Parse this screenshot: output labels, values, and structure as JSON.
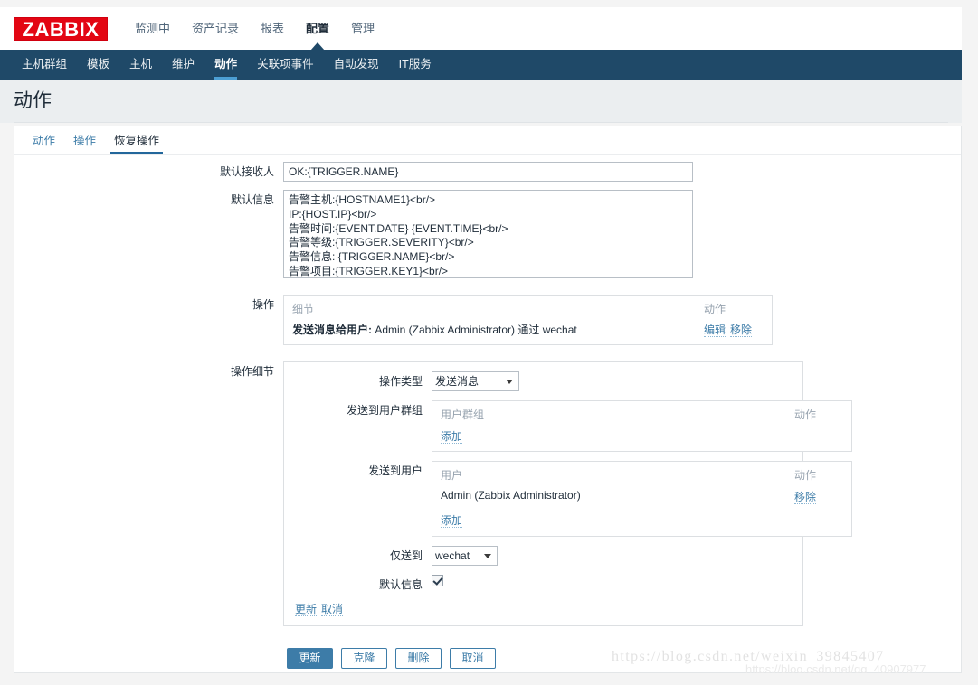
{
  "brand": {
    "logo_text": "ZABBIX",
    "logo_bg": "#e30613"
  },
  "topnav": {
    "items": [
      {
        "label": "监测中",
        "active": false
      },
      {
        "label": "资产记录",
        "active": false
      },
      {
        "label": "报表",
        "active": false
      },
      {
        "label": "配置",
        "active": true
      },
      {
        "label": "管理",
        "active": false
      }
    ]
  },
  "subnav": {
    "items": [
      {
        "label": "主机群组",
        "active": false
      },
      {
        "label": "模板",
        "active": false
      },
      {
        "label": "主机",
        "active": false
      },
      {
        "label": "维护",
        "active": false
      },
      {
        "label": "动作",
        "active": true
      },
      {
        "label": "关联项事件",
        "active": false
      },
      {
        "label": "自动发现",
        "active": false
      },
      {
        "label": "IT服务",
        "active": false
      }
    ]
  },
  "page": {
    "title": "动作"
  },
  "tabs": [
    {
      "label": "动作",
      "active": false
    },
    {
      "label": "操作",
      "active": false
    },
    {
      "label": "恢复操作",
      "active": true
    }
  ],
  "form": {
    "default_subject": {
      "label": "默认接收人",
      "value": "OK:{TRIGGER.NAME}"
    },
    "default_message": {
      "label": "默认信息",
      "value": "告警主机:{HOSTNAME1}<br/>\nIP:{HOST.IP}<br/>\n告警时间:{EVENT.DATE} {EVENT.TIME}<br/>\n告警等级:{TRIGGER.SEVERITY}<br/>\n告警信息: {TRIGGER.NAME}<br/>\n告警项目:{TRIGGER.KEY1}<br/>\n问题详情:{ITEM.NAME}:{ITEM.VALUE}<br/>"
    },
    "operations": {
      "label": "操作",
      "col_details": "细节",
      "col_action": "动作",
      "rows": [
        {
          "prefix": "发送消息给用户:",
          "text": " Admin (Zabbix Administrator) 通过 wechat",
          "edit": "编辑",
          "remove": "移除"
        }
      ]
    },
    "operation_details": {
      "label": "操作细节",
      "operation_type": {
        "label": "操作类型",
        "value": "发送消息",
        "options": [
          "发送消息"
        ]
      },
      "send_to_user_groups": {
        "label": "发送到用户群组",
        "col_group": "用户群组",
        "col_action": "动作",
        "rows": [],
        "add": "添加"
      },
      "send_to_users": {
        "label": "发送到用户",
        "col_user": "用户",
        "col_action": "动作",
        "rows": [
          {
            "name": "Admin (Zabbix Administrator)",
            "remove": "移除"
          }
        ],
        "add": "添加"
      },
      "send_only_to": {
        "label": "仅送到",
        "value": "wechat",
        "options": [
          "wechat"
        ]
      },
      "default_message": {
        "label": "默认信息",
        "checked": true
      },
      "footer": {
        "update": "更新",
        "cancel": "取消"
      }
    }
  },
  "buttons": {
    "update": "更新",
    "clone": "克隆",
    "delete": "删除",
    "cancel": "取消"
  },
  "watermarks": {
    "primary": "https://blog.csdn.net/weixin_39845407",
    "secondary": "https://blog.csdn.net/qq_40907977"
  }
}
